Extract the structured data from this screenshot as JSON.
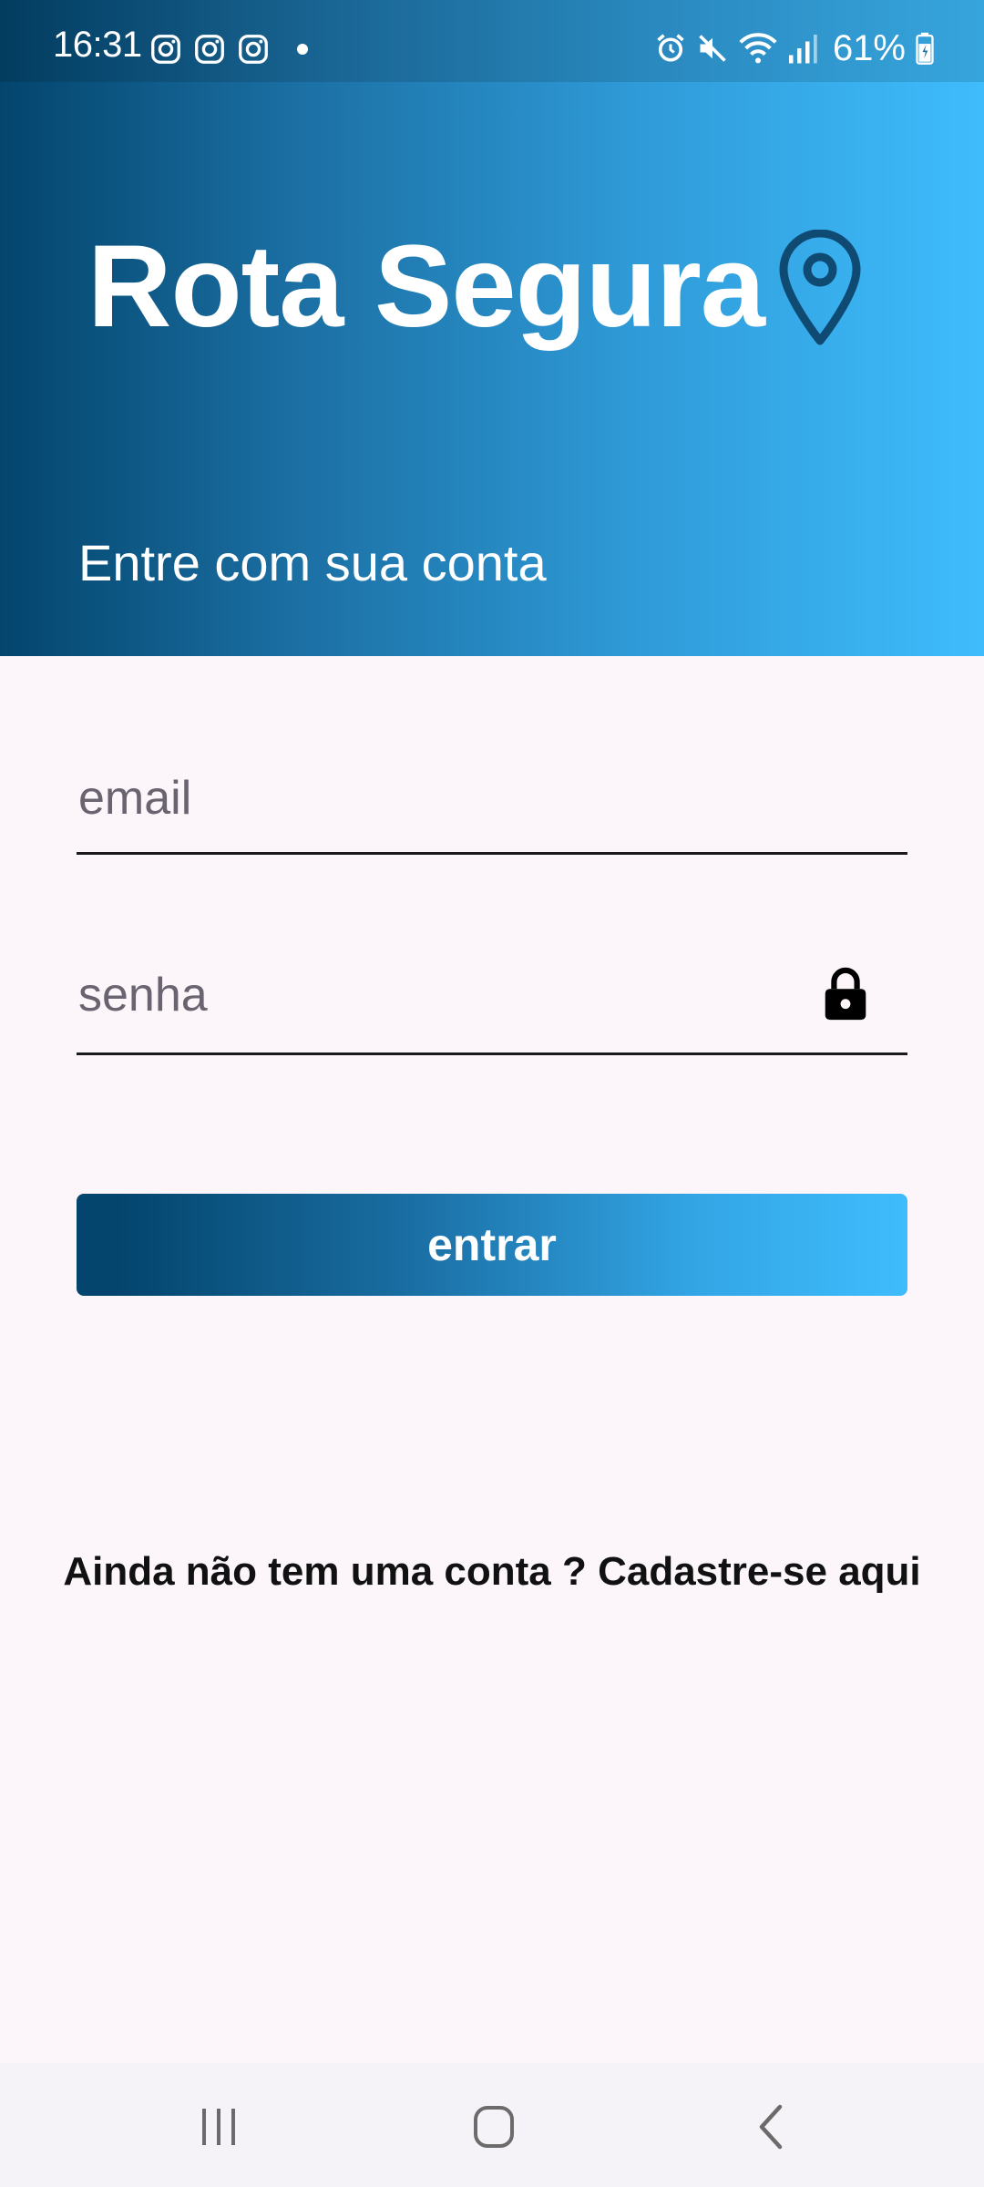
{
  "status_bar": {
    "time": "16:31",
    "battery": "61%",
    "left_icons": [
      "instagram-icon",
      "instagram-icon",
      "instagram-icon",
      "notification-dot"
    ],
    "right_icons": [
      "alarm-icon",
      "mute-icon",
      "wifi-icon",
      "signal-icon",
      "battery-icon"
    ]
  },
  "header": {
    "title": "Rota Segura",
    "title_icon": "location-pin-icon",
    "subtitle": "Entre com sua conta",
    "gradient": [
      "#03456d",
      "#3fbcfc"
    ]
  },
  "form": {
    "email_placeholder": "email",
    "email_value": "",
    "password_placeholder": "senha",
    "password_value": "",
    "password_icon": "lock-icon",
    "submit_label": "entrar"
  },
  "signup": {
    "text": "Ainda não tem uma conta ? Cadastre-se aqui"
  },
  "nav_bar": {
    "buttons": [
      "recent-apps-icon",
      "home-icon",
      "back-icon"
    ]
  },
  "colors": {
    "background": "#fcf6fb",
    "accent_dark": "#03456d",
    "accent_light": "#3fbcfc",
    "text": "#111111"
  }
}
